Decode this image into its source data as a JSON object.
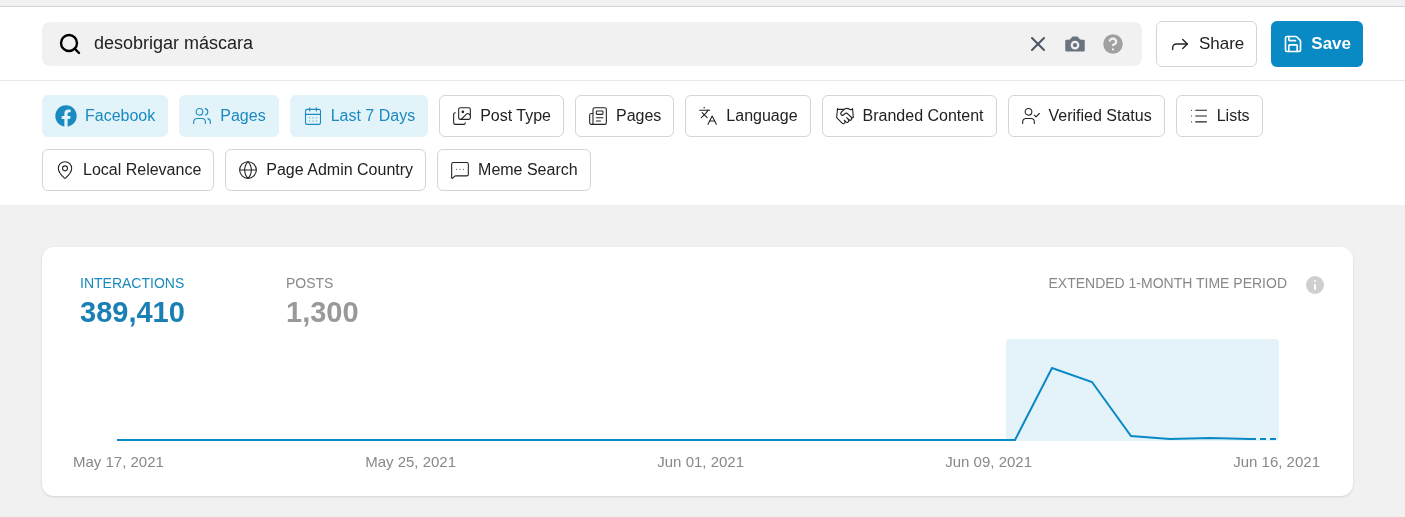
{
  "search": {
    "value": "desobrigar máscara"
  },
  "actions": [
    {
      "label": "Share",
      "kind": "share"
    },
    {
      "label": "Save",
      "kind": "save"
    }
  ],
  "filters": [
    {
      "label": "Facebook",
      "selected": true
    },
    {
      "label": "Pages",
      "selected": true
    },
    {
      "label": "Last 7 Days",
      "selected": true
    },
    {
      "label": "Post Type",
      "selected": false
    },
    {
      "label": "Pages",
      "selected": false
    },
    {
      "label": "Language",
      "selected": false
    },
    {
      "label": "Branded Content",
      "selected": false
    },
    {
      "label": "Verified Status",
      "selected": false
    },
    {
      "label": "Lists",
      "selected": false
    },
    {
      "label": "Local Relevance",
      "selected": false
    },
    {
      "label": "Page Admin Country",
      "selected": false
    },
    {
      "label": "Meme Search",
      "selected": false
    }
  ],
  "metrics": [
    {
      "label": "INTERACTIONS",
      "value": "389,410",
      "selected": true
    },
    {
      "label": "POSTS",
      "value": "1,300",
      "selected": false
    }
  ],
  "period_note": "EXTENDED 1-MONTH TIME PERIOD",
  "x_labels": [
    "May 17, 2021",
    "May 25, 2021",
    "Jun 01, 2021",
    "Jun 09, 2021",
    "Jun 16, 2021"
  ]
}
